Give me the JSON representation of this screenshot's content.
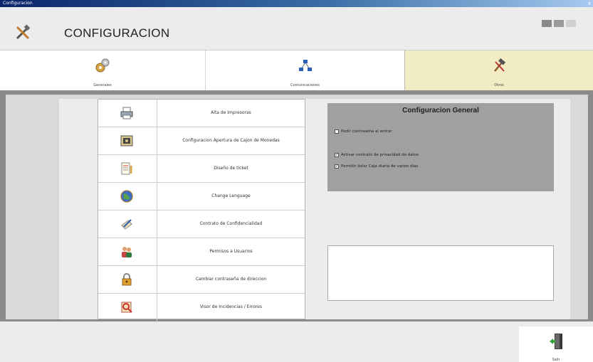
{
  "window": {
    "title": "Configuracion",
    "close_glyph": "x"
  },
  "header": {
    "title": "CONFIGURACION",
    "icon": "tools-icon"
  },
  "tabs": [
    {
      "label": "Generales",
      "icon": "gears-icon",
      "active": false
    },
    {
      "label": "Comunicaciones",
      "icon": "network-icon",
      "active": false
    },
    {
      "label": "Otros",
      "icon": "hammer-icon",
      "active": true
    }
  ],
  "options": [
    {
      "label": "Alta de Impresoras",
      "icon": "printer-icon"
    },
    {
      "label": "Configuracion Apertura de Cajon de Monedas",
      "icon": "safe-icon"
    },
    {
      "label": "Diseño de ticket",
      "icon": "ticket-design-icon"
    },
    {
      "label": "Change Lenguage",
      "icon": "globe-icon"
    },
    {
      "label": "Contrato de Confidencialidad",
      "icon": "contract-icon"
    },
    {
      "label": "Permisos a Usuarios",
      "icon": "users-icon"
    },
    {
      "label": "Cambiar contraseña de direccion",
      "icon": "padlock-icon"
    },
    {
      "label": "Visor de Incidencias / Errores",
      "icon": "bug-viewer-icon"
    }
  ],
  "config_general": {
    "title": "Configuracion General",
    "checkboxes": [
      {
        "label": "Pedir contraseña al entrar",
        "checked": false
      },
      {
        "label": "Activar contrato de privacidad de datos",
        "checked": true
      },
      {
        "label": "Permitir listar Caja diaria de varios dias",
        "checked": true
      }
    ]
  },
  "exit_button": {
    "label": "Salir",
    "icon": "exit-door-icon"
  },
  "colors": {
    "active_tab": "#f1ecc4",
    "panel_gray": "#a0a0a0",
    "frame_gray": "#8b8b8b"
  }
}
